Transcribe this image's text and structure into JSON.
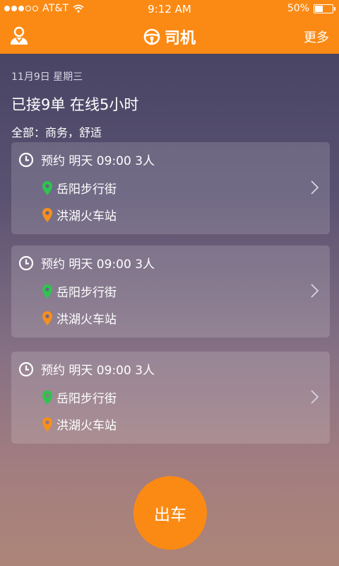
{
  "status_bar": {
    "carrier": "AT&T",
    "time": "9:12 AM",
    "battery_text": "50%",
    "battery_level": 0.5,
    "signal_bars_filled": 3,
    "signal_bars_total": 5,
    "wifi_icon": "wifi-icon"
  },
  "navbar": {
    "title": "司机",
    "title_icon": "steering-wheel-icon",
    "left_icon": "user-profile-icon",
    "more_label": "更多"
  },
  "summary": {
    "date": "11月9日  星期三",
    "stats": "已接9单  在线5小时",
    "filter": "全部：商务，舒适"
  },
  "orders": [
    {
      "time_text": "预约  明天 09:00  3人",
      "from": "岳阳步行街",
      "to": "洪湖火车站"
    },
    {
      "time_text": "预约  明天 09:00  3人",
      "from": "岳阳步行街",
      "to": "洪湖火车站"
    },
    {
      "time_text": "预约  明天 09:00  3人",
      "from": "岳阳步行街",
      "to": "洪湖火车站"
    }
  ],
  "go_button": {
    "label": "出车"
  },
  "colors": {
    "brand_orange": "#fb8a14",
    "pickup_green": "#2ec44f",
    "dropoff_orange": "#f5901c"
  }
}
